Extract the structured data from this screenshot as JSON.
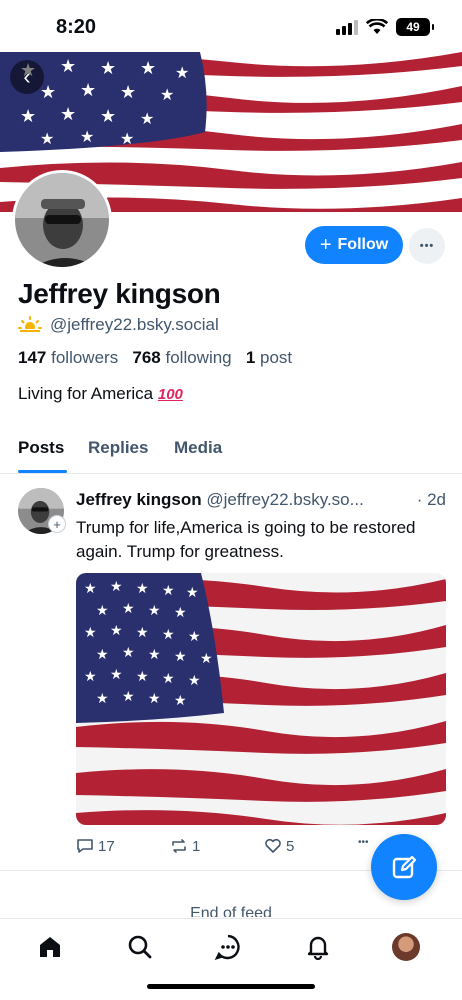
{
  "status_bar": {
    "time": "8:20",
    "battery": "49"
  },
  "profile": {
    "display_name": "Jeffrey kingson",
    "handle": "@jeffrey22.bsky.social",
    "follow_label": "Follow",
    "more_label": "•••",
    "followers_count": "147",
    "followers_label": "followers",
    "following_count": "768",
    "following_label": "following",
    "posts_count": "1",
    "posts_label": "post",
    "bio": "Living for America",
    "bio_emoji": "100"
  },
  "tabs": [
    {
      "label": "Posts",
      "active": true
    },
    {
      "label": "Replies",
      "active": false
    },
    {
      "label": "Media",
      "active": false
    }
  ],
  "post": {
    "author": "Jeffrey kingson",
    "handle": "@jeffrey22.bsky.so...",
    "time": "· 2d",
    "text": "Trump for life,America is going to be restored again. Trump for greatness.",
    "replies": "17",
    "reposts": "1",
    "likes": "5",
    "more": "•••"
  },
  "feed_end": "End of feed",
  "nav": {
    "items": [
      "home-icon",
      "search-icon",
      "chat-icon",
      "bell-icon",
      "avatar"
    ]
  },
  "colors": {
    "accent": "#1183fe",
    "muted": "#42576c",
    "flag_red": "#b22234",
    "flag_blue": "#2a2f6e"
  }
}
